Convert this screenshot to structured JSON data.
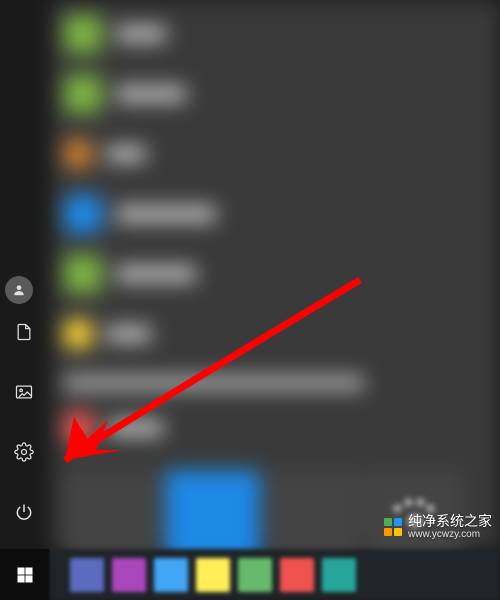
{
  "rail": {
    "user": {
      "name": "user-account-icon"
    },
    "documents": {
      "name": "documents-icon"
    },
    "pictures": {
      "name": "pictures-icon"
    },
    "settings": {
      "name": "settings-icon"
    },
    "power": {
      "name": "power-icon"
    },
    "start": {
      "name": "start-icon"
    }
  },
  "apps": [
    {
      "color": "#7cb342",
      "labelWidth": 50
    },
    {
      "color": "#7cb342",
      "labelWidth": 70
    },
    {
      "color": "#d08030",
      "labelWidth": 40
    },
    {
      "color": "#1e88e5",
      "labelWidth": 100
    },
    {
      "color": "#7cb342",
      "labelWidth": 80
    },
    {
      "color": "#fdd835",
      "labelWidth": 45
    }
  ],
  "lowerApps": [
    {
      "color": "#ef5350",
      "labelWidth": 55
    }
  ],
  "tiles": [
    {
      "color": "#444"
    },
    {
      "color": "#1e88e5"
    },
    {
      "color": "#444"
    },
    {
      "color": "#444"
    }
  ],
  "watermark": {
    "title": "纯净系统之家",
    "url": "www.ycwzy.com",
    "colors": [
      "#4caf50",
      "#2196f3",
      "#ff9800",
      "#ffc107"
    ]
  },
  "annotation": {
    "type": "arrow",
    "target": "settings-icon",
    "color": "#ff0000"
  },
  "taskbarItems": [
    "#5c6bc0",
    "#ab47bc",
    "#42a5f5",
    "#ffee58",
    "#66bb6a",
    "#ef5350",
    "#26a69a"
  ]
}
